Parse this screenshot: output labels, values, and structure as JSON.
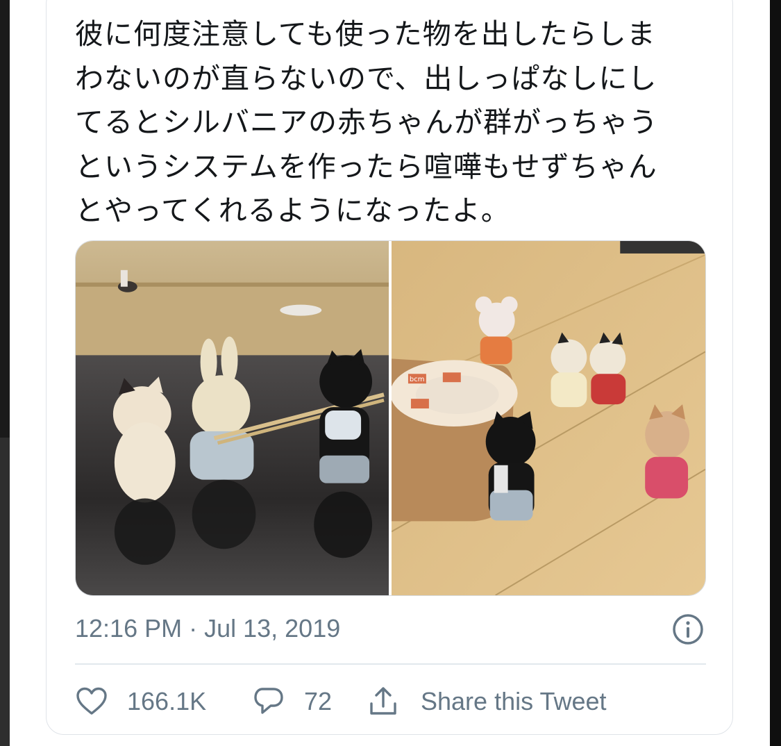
{
  "tweet": {
    "text": "彼に何度注意しても使った物を出したらしま\nわないのが直らないので、出しっぱなしにし\nてるとシルバニアの赤ちゃんが群がっちゃう\nというシステムを作ったら喧嘩もせずちゃん\nとやってくれるようになったよ。",
    "timestamp": "12:16 PM · Jul 13, 2019"
  },
  "media": {
    "photos": [
      {
        "icon": "photo-figures-chopsticks"
      },
      {
        "icon": "photo-figures-tape"
      }
    ],
    "tape_brand": "bcm"
  },
  "actions": {
    "like_icon": "heart-icon",
    "like_count": "166.1K",
    "reply_icon": "speech-bubble-icon",
    "reply_count": "72",
    "share_icon": "share-icon",
    "share_label": "Share this Tweet"
  },
  "colors": {
    "text": "#14171a",
    "secondary": "#657786",
    "border": "#e1e8ed"
  }
}
